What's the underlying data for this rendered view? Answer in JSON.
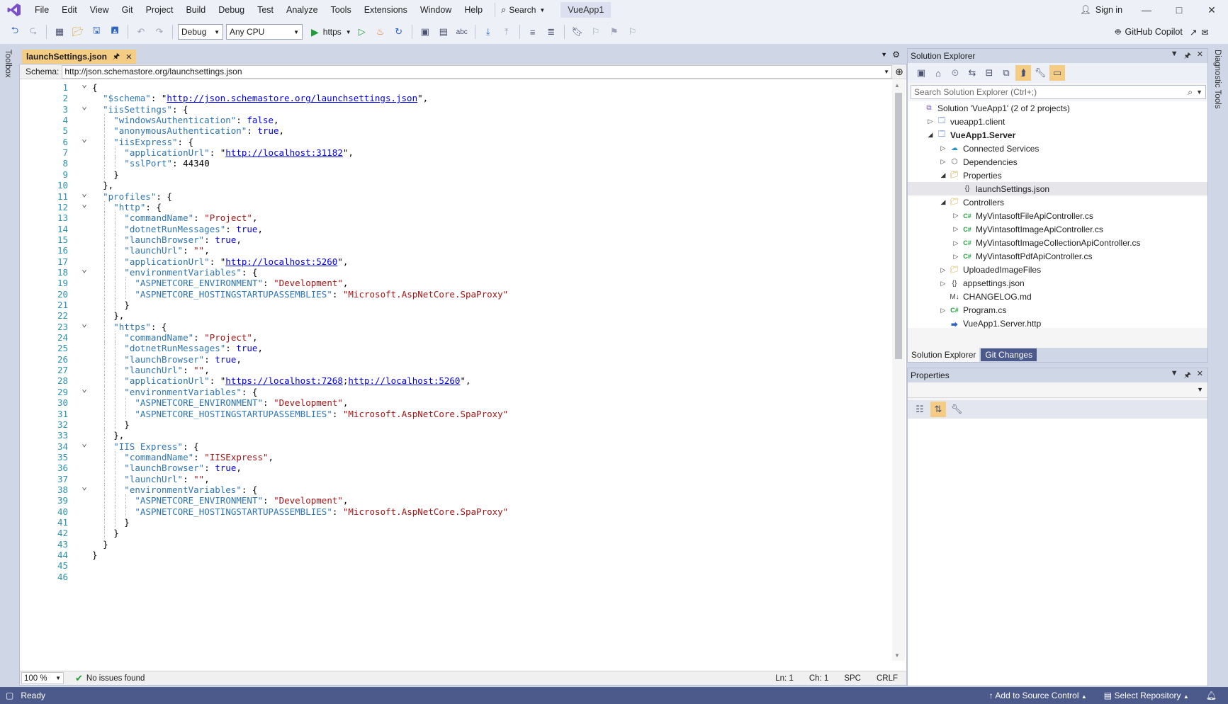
{
  "menubar": {
    "items": [
      "File",
      "Edit",
      "View",
      "Git",
      "Project",
      "Build",
      "Debug",
      "Test",
      "Analyze",
      "Tools",
      "Extensions",
      "Window",
      "Help"
    ],
    "search_label": "Search",
    "app_name": "VueApp1",
    "sign_in": "Sign in"
  },
  "toolbar": {
    "config": "Debug",
    "platform": "Any CPU",
    "run_profile": "https",
    "copilot": "GitHub Copilot"
  },
  "side_strips": {
    "left": "Toolbox",
    "right": "Diagnostic Tools"
  },
  "editor": {
    "tab_title": "launchSettings.json",
    "schema_label": "Schema:",
    "schema_value": "http://json.schemastore.org/launchsettings.json",
    "zoom": "100 %",
    "issues": "No issues found",
    "ln": "Ln: 1",
    "ch": "Ch: 1",
    "spc": "SPC",
    "crlf": "CRLF",
    "lines": [
      {
        "n": "1",
        "fold": "v",
        "indent": 0,
        "tokens": [
          [
            "p",
            "{"
          ]
        ]
      },
      {
        "n": "2",
        "fold": "",
        "indent": 1,
        "tokens": [
          [
            "k",
            "\"$schema\""
          ],
          [
            "p",
            ": \""
          ],
          [
            "u",
            "http://json.schemastore.org/launchsettings.json"
          ],
          [
            "p",
            "\","
          ]
        ]
      },
      {
        "n": "3",
        "fold": "v",
        "indent": 1,
        "tokens": [
          [
            "k",
            "\"iisSettings\""
          ],
          [
            "p",
            ": {"
          ]
        ]
      },
      {
        "n": "4",
        "fold": "",
        "indent": 2,
        "tokens": [
          [
            "k",
            "\"windowsAuthentication\""
          ],
          [
            "p",
            ": "
          ],
          [
            "b",
            "false"
          ],
          [
            "p",
            ","
          ]
        ]
      },
      {
        "n": "5",
        "fold": "",
        "indent": 2,
        "tokens": [
          [
            "k",
            "\"anonymousAuthentication\""
          ],
          [
            "p",
            ": "
          ],
          [
            "b",
            "true"
          ],
          [
            "p",
            ","
          ]
        ]
      },
      {
        "n": "6",
        "fold": "v",
        "indent": 2,
        "tokens": [
          [
            "k",
            "\"iisExpress\""
          ],
          [
            "p",
            ": {"
          ]
        ]
      },
      {
        "n": "7",
        "fold": "",
        "indent": 3,
        "tokens": [
          [
            "k",
            "\"applicationUrl\""
          ],
          [
            "p",
            ": \""
          ],
          [
            "u",
            "http://localhost:31182"
          ],
          [
            "p",
            "\","
          ]
        ]
      },
      {
        "n": "8",
        "fold": "",
        "indent": 3,
        "tokens": [
          [
            "k",
            "\"sslPort\""
          ],
          [
            "p",
            ": "
          ],
          [
            "n",
            "44340"
          ]
        ]
      },
      {
        "n": "9",
        "fold": "",
        "indent": 2,
        "tokens": [
          [
            "p",
            "}"
          ]
        ]
      },
      {
        "n": "10",
        "fold": "",
        "indent": 1,
        "tokens": [
          [
            "p",
            "},"
          ]
        ]
      },
      {
        "n": "11",
        "fold": "v",
        "indent": 1,
        "tokens": [
          [
            "k",
            "\"profiles\""
          ],
          [
            "p",
            ": {"
          ]
        ]
      },
      {
        "n": "12",
        "fold": "v",
        "indent": 2,
        "tokens": [
          [
            "k",
            "\"http\""
          ],
          [
            "p",
            ": {"
          ]
        ]
      },
      {
        "n": "13",
        "fold": "",
        "indent": 3,
        "tokens": [
          [
            "k",
            "\"commandName\""
          ],
          [
            "p",
            ": "
          ],
          [
            "s",
            "\"Project\""
          ],
          [
            "p",
            ","
          ]
        ]
      },
      {
        "n": "14",
        "fold": "",
        "indent": 3,
        "tokens": [
          [
            "k",
            "\"dotnetRunMessages\""
          ],
          [
            "p",
            ": "
          ],
          [
            "b",
            "true"
          ],
          [
            "p",
            ","
          ]
        ]
      },
      {
        "n": "15",
        "fold": "",
        "indent": 3,
        "tokens": [
          [
            "k",
            "\"launchBrowser\""
          ],
          [
            "p",
            ": "
          ],
          [
            "b",
            "true"
          ],
          [
            "p",
            ","
          ]
        ]
      },
      {
        "n": "16",
        "fold": "",
        "indent": 3,
        "tokens": [
          [
            "k",
            "\"launchUrl\""
          ],
          [
            "p",
            ": "
          ],
          [
            "s",
            "\"\""
          ],
          [
            "p",
            ","
          ]
        ]
      },
      {
        "n": "17",
        "fold": "",
        "indent": 3,
        "tokens": [
          [
            "k",
            "\"applicationUrl\""
          ],
          [
            "p",
            ": \""
          ],
          [
            "u",
            "http://localhost:5260"
          ],
          [
            "p",
            "\","
          ]
        ]
      },
      {
        "n": "18",
        "fold": "v",
        "indent": 3,
        "tokens": [
          [
            "k",
            "\"environmentVariables\""
          ],
          [
            "p",
            ": {"
          ]
        ]
      },
      {
        "n": "19",
        "fold": "",
        "indent": 4,
        "tokens": [
          [
            "k",
            "\"ASPNETCORE_ENVIRONMENT\""
          ],
          [
            "p",
            ": "
          ],
          [
            "s",
            "\"Development\""
          ],
          [
            "p",
            ","
          ]
        ]
      },
      {
        "n": "20",
        "fold": "",
        "indent": 4,
        "tokens": [
          [
            "k",
            "\"ASPNETCORE_HOSTINGSTARTUPASSEMBLIES\""
          ],
          [
            "p",
            ": "
          ],
          [
            "s",
            "\"Microsoft.AspNetCore.SpaProxy\""
          ]
        ]
      },
      {
        "n": "21",
        "fold": "",
        "indent": 3,
        "tokens": [
          [
            "p",
            "}"
          ]
        ]
      },
      {
        "n": "22",
        "fold": "",
        "indent": 2,
        "tokens": [
          [
            "p",
            "},"
          ]
        ]
      },
      {
        "n": "23",
        "fold": "v",
        "indent": 2,
        "tokens": [
          [
            "k",
            "\"https\""
          ],
          [
            "p",
            ": {"
          ]
        ]
      },
      {
        "n": "24",
        "fold": "",
        "indent": 3,
        "tokens": [
          [
            "k",
            "\"commandName\""
          ],
          [
            "p",
            ": "
          ],
          [
            "s",
            "\"Project\""
          ],
          [
            "p",
            ","
          ]
        ]
      },
      {
        "n": "25",
        "fold": "",
        "indent": 3,
        "tokens": [
          [
            "k",
            "\"dotnetRunMessages\""
          ],
          [
            "p",
            ": "
          ],
          [
            "b",
            "true"
          ],
          [
            "p",
            ","
          ]
        ]
      },
      {
        "n": "26",
        "fold": "",
        "indent": 3,
        "tokens": [
          [
            "k",
            "\"launchBrowser\""
          ],
          [
            "p",
            ": "
          ],
          [
            "b",
            "true"
          ],
          [
            "p",
            ","
          ]
        ]
      },
      {
        "n": "27",
        "fold": "",
        "indent": 3,
        "tokens": [
          [
            "k",
            "\"launchUrl\""
          ],
          [
            "p",
            ": "
          ],
          [
            "s",
            "\"\""
          ],
          [
            "p",
            ","
          ]
        ]
      },
      {
        "n": "28",
        "fold": "",
        "indent": 3,
        "tokens": [
          [
            "k",
            "\"applicationUrl\""
          ],
          [
            "p",
            ": \""
          ],
          [
            "u",
            "https://localhost:7268"
          ],
          [
            "p",
            ";"
          ],
          [
            "u",
            "http://localhost:5260"
          ],
          [
            "p",
            "\","
          ]
        ]
      },
      {
        "n": "29",
        "fold": "v",
        "indent": 3,
        "tokens": [
          [
            "k",
            "\"environmentVariables\""
          ],
          [
            "p",
            ": {"
          ]
        ]
      },
      {
        "n": "30",
        "fold": "",
        "indent": 4,
        "tokens": [
          [
            "k",
            "\"ASPNETCORE_ENVIRONMENT\""
          ],
          [
            "p",
            ": "
          ],
          [
            "s",
            "\"Development\""
          ],
          [
            "p",
            ","
          ]
        ]
      },
      {
        "n": "31",
        "fold": "",
        "indent": 4,
        "tokens": [
          [
            "k",
            "\"ASPNETCORE_HOSTINGSTARTUPASSEMBLIES\""
          ],
          [
            "p",
            ": "
          ],
          [
            "s",
            "\"Microsoft.AspNetCore.SpaProxy\""
          ]
        ]
      },
      {
        "n": "32",
        "fold": "",
        "indent": 3,
        "tokens": [
          [
            "p",
            "}"
          ]
        ]
      },
      {
        "n": "33",
        "fold": "",
        "indent": 2,
        "tokens": [
          [
            "p",
            "},"
          ]
        ]
      },
      {
        "n": "34",
        "fold": "v",
        "indent": 2,
        "tokens": [
          [
            "k",
            "\"IIS Express\""
          ],
          [
            "p",
            ": {"
          ]
        ]
      },
      {
        "n": "35",
        "fold": "",
        "indent": 3,
        "tokens": [
          [
            "k",
            "\"commandName\""
          ],
          [
            "p",
            ": "
          ],
          [
            "s",
            "\"IISExpress\""
          ],
          [
            "p",
            ","
          ]
        ]
      },
      {
        "n": "36",
        "fold": "",
        "indent": 3,
        "tokens": [
          [
            "k",
            "\"launchBrowser\""
          ],
          [
            "p",
            ": "
          ],
          [
            "b",
            "true"
          ],
          [
            "p",
            ","
          ]
        ]
      },
      {
        "n": "37",
        "fold": "",
        "indent": 3,
        "tokens": [
          [
            "k",
            "\"launchUrl\""
          ],
          [
            "p",
            ": "
          ],
          [
            "s",
            "\"\""
          ],
          [
            "p",
            ","
          ]
        ]
      },
      {
        "n": "38",
        "fold": "v",
        "indent": 3,
        "tokens": [
          [
            "k",
            "\"environmentVariables\""
          ],
          [
            "p",
            ": {"
          ]
        ]
      },
      {
        "n": "39",
        "fold": "",
        "indent": 4,
        "tokens": [
          [
            "k",
            "\"ASPNETCORE_ENVIRONMENT\""
          ],
          [
            "p",
            ": "
          ],
          [
            "s",
            "\"Development\""
          ],
          [
            "p",
            ","
          ]
        ]
      },
      {
        "n": "40",
        "fold": "",
        "indent": 4,
        "tokens": [
          [
            "k",
            "\"ASPNETCORE_HOSTINGSTARTUPASSEMBLIES\""
          ],
          [
            "p",
            ": "
          ],
          [
            "s",
            "\"Microsoft.AspNetCore.SpaProxy\""
          ]
        ]
      },
      {
        "n": "41",
        "fold": "",
        "indent": 3,
        "tokens": [
          [
            "p",
            "}"
          ]
        ]
      },
      {
        "n": "42",
        "fold": "",
        "indent": 2,
        "tokens": [
          [
            "p",
            "}"
          ]
        ]
      },
      {
        "n": "43",
        "fold": "",
        "indent": 1,
        "tokens": [
          [
            "p",
            "}"
          ]
        ]
      },
      {
        "n": "44",
        "fold": "",
        "indent": 0,
        "tokens": [
          [
            "p",
            "}"
          ]
        ]
      },
      {
        "n": "45",
        "fold": "",
        "indent": 0,
        "tokens": []
      },
      {
        "n": "46",
        "fold": "",
        "indent": 0,
        "tokens": []
      }
    ]
  },
  "solution_explorer": {
    "title": "Solution Explorer",
    "search_placeholder": "Search Solution Explorer (Ctrl+;)",
    "tabs": [
      "Solution Explorer",
      "Git Changes"
    ],
    "tree": [
      {
        "label": "Solution 'VueApp1' (2 of 2 projects)",
        "level": 0,
        "arrow": "",
        "icon": "solution-icon",
        "bold": false,
        "selected": false
      },
      {
        "label": "vueapp1.client",
        "level": 1,
        "arrow": "right",
        "icon": "web-project-icon",
        "bold": false,
        "selected": false
      },
      {
        "label": "VueApp1.Server",
        "level": 1,
        "arrow": "down",
        "icon": "csharp-project-icon",
        "bold": true,
        "selected": false
      },
      {
        "label": "Connected Services",
        "level": 2,
        "arrow": "right",
        "icon": "connected-services-icon",
        "bold": false,
        "selected": false
      },
      {
        "label": "Dependencies",
        "level": 2,
        "arrow": "right",
        "icon": "dependencies-icon",
        "bold": false,
        "selected": false
      },
      {
        "label": "Properties",
        "level": 2,
        "arrow": "down",
        "icon": "properties-folder-icon",
        "bold": false,
        "selected": false
      },
      {
        "label": "launchSettings.json",
        "level": 3,
        "arrow": "",
        "icon": "json-file-icon",
        "bold": false,
        "selected": true
      },
      {
        "label": "Controllers",
        "level": 2,
        "arrow": "down",
        "icon": "folder-icon",
        "bold": false,
        "selected": false
      },
      {
        "label": "MyVintasoftFileApiController.cs",
        "level": 3,
        "arrow": "right",
        "icon": "csharp-file-icon",
        "bold": false,
        "selected": false
      },
      {
        "label": "MyVintasoftImageApiController.cs",
        "level": 3,
        "arrow": "right",
        "icon": "csharp-file-icon",
        "bold": false,
        "selected": false
      },
      {
        "label": "MyVintasoftImageCollectionApiController.cs",
        "level": 3,
        "arrow": "right",
        "icon": "csharp-file-icon",
        "bold": false,
        "selected": false
      },
      {
        "label": "MyVintasoftPdfApiController.cs",
        "level": 3,
        "arrow": "right",
        "icon": "csharp-file-icon",
        "bold": false,
        "selected": false
      },
      {
        "label": "UploadedImageFiles",
        "level": 2,
        "arrow": "right",
        "icon": "folder-icon",
        "bold": false,
        "selected": false
      },
      {
        "label": "appsettings.json",
        "level": 2,
        "arrow": "right",
        "icon": "json-file-icon",
        "bold": false,
        "selected": false
      },
      {
        "label": "CHANGELOG.md",
        "level": 2,
        "arrow": "",
        "icon": "markdown-file-icon",
        "bold": false,
        "selected": false
      },
      {
        "label": "Program.cs",
        "level": 2,
        "arrow": "right",
        "icon": "csharp-file-icon",
        "bold": false,
        "selected": false
      },
      {
        "label": "VueApp1.Server.http",
        "level": 2,
        "arrow": "",
        "icon": "http-file-icon",
        "bold": false,
        "selected": false
      }
    ]
  },
  "properties": {
    "title": "Properties"
  },
  "statusbar": {
    "ready": "Ready",
    "source_control": "Add to Source Control",
    "repository": "Select Repository"
  },
  "colors": {
    "accent": "#4c5a8b",
    "tab_active": "#f5cc84",
    "string": "#a31515",
    "key": "#2e75b6",
    "keyword": "#0000ff"
  }
}
